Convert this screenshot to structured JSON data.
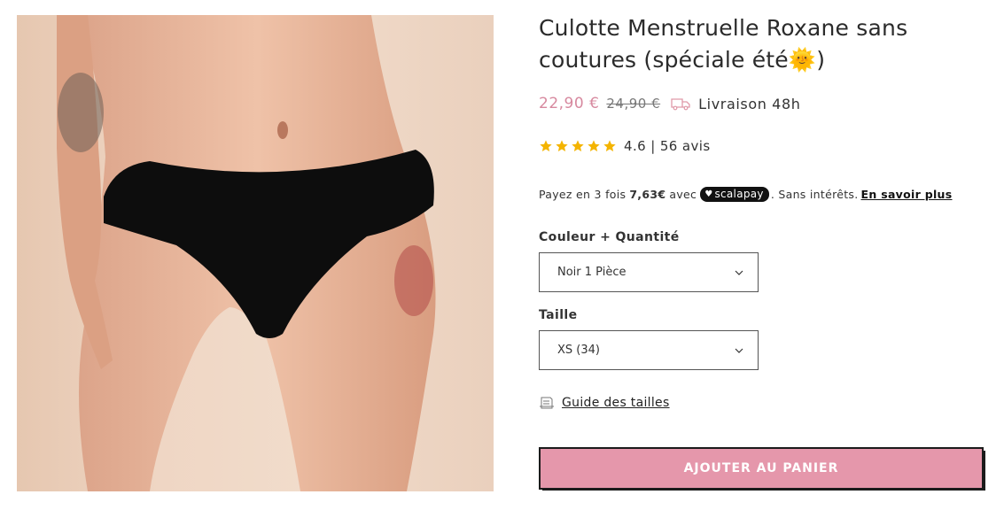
{
  "product": {
    "title": "Culotte Menstruelle Roxane sans coutures (spéciale été🌞)",
    "price_sale": "22,90 €",
    "price_old": "24,90 €",
    "shipping": "Livraison 48h",
    "rating_text": "4.6 | 56 avis",
    "rating": 4.6,
    "rating_max": 5
  },
  "payment": {
    "prefix": "Payez en 3 fois",
    "amount": "7,63€",
    "with": "avec",
    "provider": "scalapay",
    "suffix": ". Sans intérêts.",
    "learn_more": "En savoir plus"
  },
  "options": {
    "color_label": "Couleur + Quantité",
    "color_value": "Noir 1 Pièce",
    "size_label": "Taille",
    "size_value": "XS (34)"
  },
  "guide_label": "Guide des tailles",
  "cart_label": "AJOUTER AU PANIER",
  "icons": {
    "truck": "delivery-truck-icon",
    "star": "star-icon",
    "chevron": "chevron-down-icon",
    "guide": "size-guide-icon",
    "heart": "heart-icon"
  },
  "colors": {
    "sale_price": "#d7899f",
    "cart_button": "#e597ab",
    "star": "#f4b400"
  }
}
